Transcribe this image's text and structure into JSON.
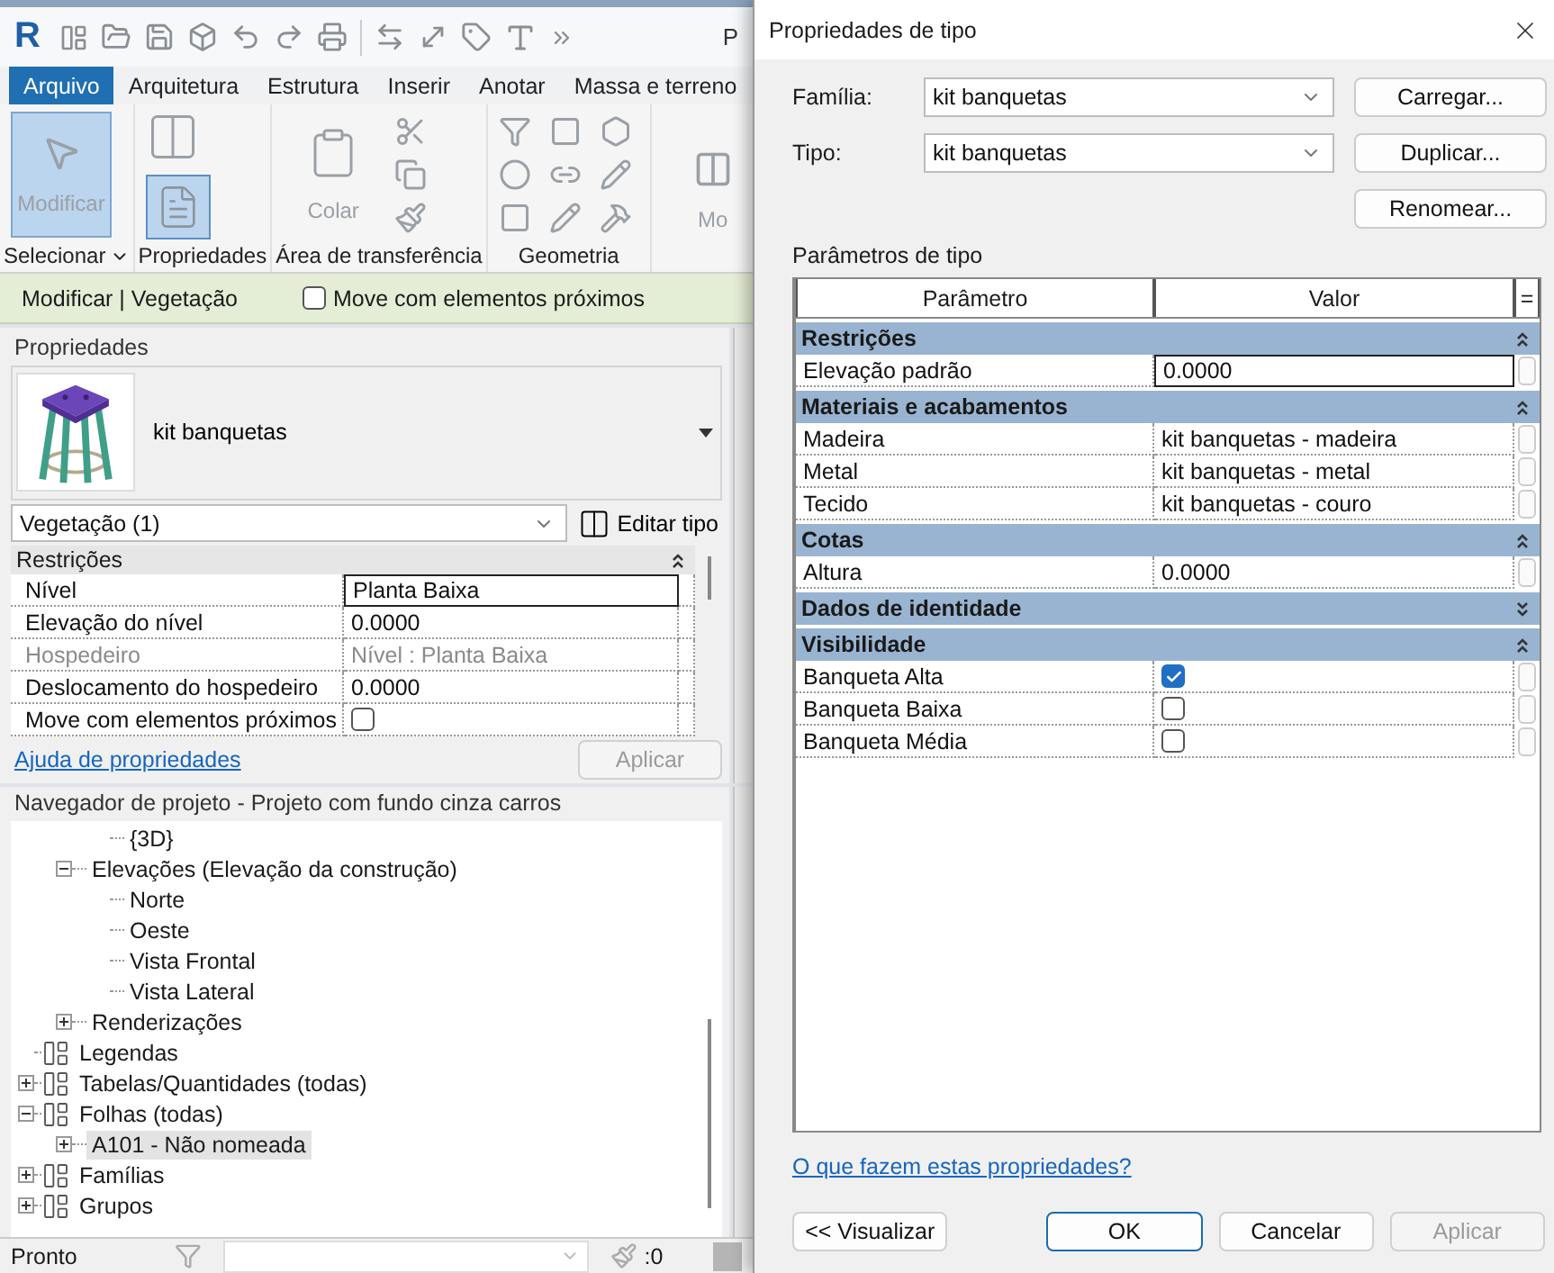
{
  "app": {
    "logo": "R",
    "title_fragment": "P"
  },
  "ribbon": {
    "tabs": [
      {
        "label": "Arquivo",
        "kind": "file"
      },
      {
        "label": "Arquitetura",
        "kind": "tab"
      },
      {
        "label": "Estrutura",
        "kind": "tab"
      },
      {
        "label": "Inserir",
        "kind": "tab"
      },
      {
        "label": "Anotar",
        "kind": "tab"
      },
      {
        "label": "Massa e terreno",
        "kind": "tab"
      }
    ],
    "panels": [
      {
        "kind": "select",
        "label": "Selecionar",
        "button": "Modificar",
        "active": true
      },
      {
        "kind": "properties",
        "label": "Propriedades",
        "active": true
      },
      {
        "kind": "clipboard",
        "label": "Área de transferência",
        "button": "Colar"
      },
      {
        "kind": "geometry",
        "label": "Geometria"
      },
      {
        "kind": "cut",
        "button": "Mo"
      }
    ]
  },
  "context_bar": {
    "label": "Modificar | Vegetação",
    "option": {
      "label": "Move com elementos próximos",
      "checked": false
    }
  },
  "properties": {
    "title": "Propriedades",
    "type_name": "kit banquetas",
    "filter": "Vegetação (1)",
    "edit_type": "Editar tipo",
    "groups": [
      {
        "label": "Restrições",
        "expanded": true,
        "rows": [
          {
            "kind": "text",
            "name": "Nível",
            "value": "Planta Baixa",
            "selected": true,
            "disabled": false
          },
          {
            "kind": "text",
            "name": "Elevação do nível",
            "value": "0.0000",
            "selected": false,
            "disabled": false
          },
          {
            "kind": "text",
            "name": "Hospedeiro",
            "value": "Nível : Planta Baixa",
            "selected": false,
            "disabled": true
          },
          {
            "kind": "text",
            "name": "Deslocamento do hospedeiro",
            "value": "0.0000",
            "selected": false,
            "disabled": false
          },
          {
            "kind": "checkbox",
            "name": "Move com elementos próximos",
            "checked": false,
            "selected": false,
            "disabled": false
          }
        ]
      }
    ],
    "help_link": "Ajuda de propriedades",
    "apply": {
      "label": "Aplicar",
      "disabled": true
    }
  },
  "browser": {
    "title": "Navegador de projeto - Projeto com fundo cinza carros",
    "items": [
      {
        "children": [
          {
            "children": [
              {
                "label": "{3D}",
                "selected": false
              }
            ]
          },
          {
            "label": "Elevações (Elevação da construção)",
            "expanded": true,
            "selected": false,
            "children": [
              {
                "label": "Norte",
                "selected": false
              },
              {
                "label": "Oeste",
                "selected": false
              },
              {
                "label": "Vista Frontal",
                "selected": false
              },
              {
                "label": "Vista Lateral",
                "selected": false
              }
            ]
          },
          {
            "label": "Renderizações",
            "expanded": false,
            "selected": false
          }
        ]
      },
      {
        "label": "Legendas",
        "selected": false
      },
      {
        "label": "Tabelas/Quantidades (todas)",
        "expanded": false,
        "selected": false
      },
      {
        "label": "Folhas (todas)",
        "expanded": true,
        "selected": false,
        "children": [
          {
            "label": "A101 - Não nomeada",
            "expanded": false,
            "selected": true
          }
        ]
      },
      {
        "label": "Famílias",
        "expanded": false,
        "selected": false
      },
      {
        "label": "Grupos",
        "expanded": false,
        "selected": false
      }
    ]
  },
  "status_bar": {
    "text": "Pronto",
    "count": ":0"
  },
  "dialog": {
    "title": "Propriedades de tipo",
    "fields": [
      {
        "label": "Família:",
        "value": "kit banquetas"
      },
      {
        "label": "Tipo:",
        "value": "kit banquetas"
      }
    ],
    "side_buttons": [
      "Carregar...",
      "Duplicar...",
      "Renomear..."
    ],
    "section": "Parâmetros de tipo",
    "columns": [
      "Parâmetro",
      "Valor",
      "="
    ],
    "groups": [
      {
        "label": "Restrições",
        "expanded": true,
        "rows": [
          {
            "kind": "text",
            "name": "Elevação padrão",
            "value": "0.0000",
            "selected": true
          }
        ]
      },
      {
        "label": "Materiais e acabamentos",
        "expanded": true,
        "rows": [
          {
            "kind": "text",
            "name": "Madeira",
            "value": "kit banquetas - madeira",
            "selected": false
          },
          {
            "kind": "text",
            "name": "Metal",
            "value": "kit banquetas - metal",
            "selected": false
          },
          {
            "kind": "text",
            "name": "Tecido",
            "value": "kit banquetas - couro",
            "selected": false
          }
        ]
      },
      {
        "label": "Cotas",
        "expanded": true,
        "rows": [
          {
            "kind": "text",
            "name": "Altura",
            "value": "0.0000",
            "selected": false
          }
        ]
      },
      {
        "label": "Dados de identidade",
        "expanded": false
      },
      {
        "label": "Visibilidade",
        "expanded": true,
        "rows": [
          {
            "kind": "checkbox",
            "name": "Banqueta Alta",
            "checked": true,
            "selected": false
          },
          {
            "kind": "checkbox",
            "name": "Banqueta Baixa",
            "checked": false,
            "selected": false
          },
          {
            "kind": "checkbox",
            "name": "Banqueta Média",
            "checked": false,
            "selected": false
          }
        ]
      }
    ],
    "help_link": "O que fazem estas propriedades?",
    "buttons": [
      {
        "label": "<< Visualizar",
        "primary": false,
        "disabled": false
      },
      {
        "label": "OK",
        "primary": true,
        "disabled": false
      },
      {
        "label": "Cancelar",
        "primary": false,
        "disabled": false
      },
      {
        "label": "Aplicar",
        "primary": false,
        "disabled": true
      }
    ]
  }
}
